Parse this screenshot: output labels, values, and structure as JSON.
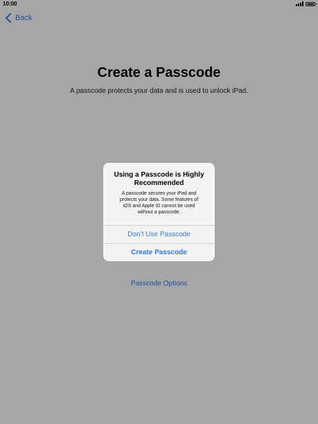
{
  "status_bar": {
    "time": "10:00"
  },
  "nav": {
    "back_label": "Back"
  },
  "main": {
    "title": "Create a Passcode",
    "subtitle": "A passcode protects your data and is used to unlock iPad.",
    "passcode_options_label": "Passcode Options"
  },
  "alert": {
    "title_line1": "Using a Passcode is Highly",
    "title_line2": "Recommended",
    "message_line1": "A passcode secures your iPad and",
    "message_line2": "protects your data. Some features of",
    "message_line3": "iOS and Apple ID cannot be used",
    "message_line4": "without a passcode.",
    "button_dont_use": "Don’t Use Passcode",
    "button_create": "Create Passcode"
  },
  "icons": {
    "back": "chevron-left-icon",
    "signal": "cellular-signal-icon",
    "battery": "battery-icon"
  },
  "colors": {
    "accent": "#2f7bf6",
    "overlay": "rgba(0,0,0,0.35)",
    "alert_bg": "#f4f4f4"
  }
}
